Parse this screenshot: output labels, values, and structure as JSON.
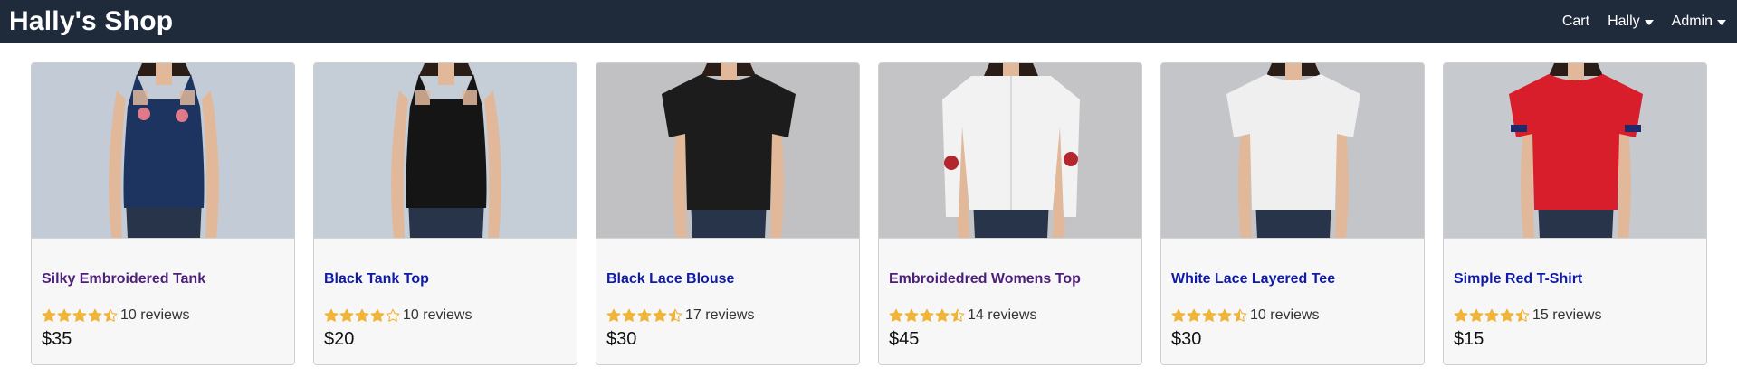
{
  "nav": {
    "brand": "Hally's Shop",
    "cart": "Cart",
    "user_menu": "Hally",
    "admin_menu": "Admin"
  },
  "products": [
    {
      "name": "Silky Embroidered Tank",
      "rating": 4.5,
      "reviews": "10 reviews",
      "price": "$35",
      "visited": true,
      "photo": {
        "bg": "#c3ccd6",
        "top_color": "#1d3461",
        "style": "tank",
        "accent": "#e07a8a"
      }
    },
    {
      "name": "Black Tank Top",
      "rating": 4.0,
      "reviews": "10 reviews",
      "price": "$20",
      "visited": false,
      "photo": {
        "bg": "#c5cdd6",
        "top_color": "#151515",
        "style": "tank",
        "accent": ""
      }
    },
    {
      "name": "Black Lace Blouse",
      "rating": 4.5,
      "reviews": "17 reviews",
      "price": "$30",
      "visited": false,
      "photo": {
        "bg": "#c1c1c3",
        "top_color": "#1c1c1c",
        "style": "tee",
        "accent": ""
      }
    },
    {
      "name": "Embroidedred Womens Top",
      "rating": 4.5,
      "reviews": "14 reviews",
      "price": "$45",
      "visited": true,
      "photo": {
        "bg": "#c4c4c6",
        "top_color": "#f2f2f2",
        "style": "shirt",
        "accent": "#b3262e"
      }
    },
    {
      "name": "White Lace Layered Tee",
      "rating": 4.5,
      "reviews": "10 reviews",
      "price": "$30",
      "visited": false,
      "photo": {
        "bg": "#c3c5c8",
        "top_color": "#efefef",
        "style": "tee",
        "accent": ""
      }
    },
    {
      "name": "Simple Red T-Shirt",
      "rating": 4.5,
      "reviews": "15 reviews",
      "price": "$15",
      "visited": false,
      "photo": {
        "bg": "#c6c9ce",
        "top_color": "#d81e2a",
        "style": "tee",
        "accent": "#1e2a6b"
      }
    }
  ],
  "colors": {
    "star": "#f0b43a",
    "nav_bg": "#1f2b3b"
  }
}
